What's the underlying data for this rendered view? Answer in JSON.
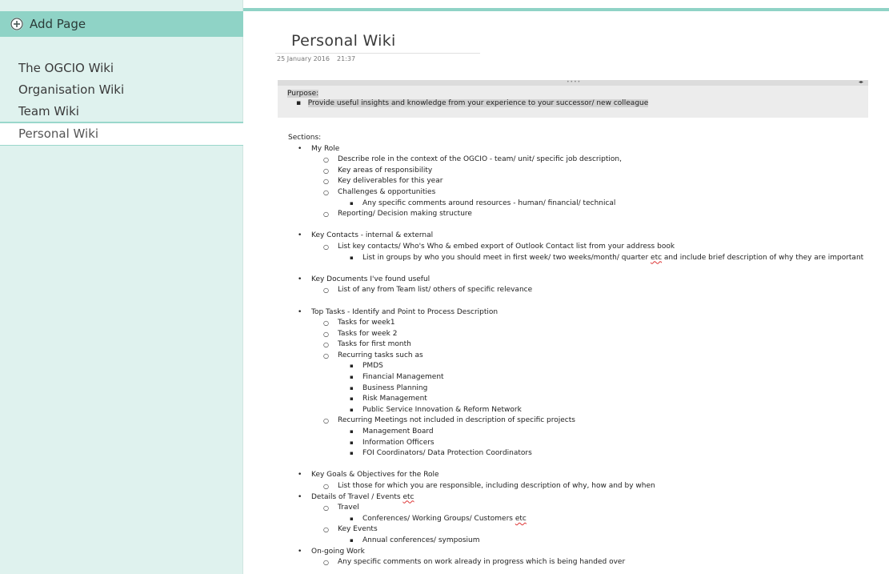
{
  "sidebar": {
    "add_page_label": "Add Page",
    "pages": [
      "The OGCIO Wiki",
      "Organisation Wiki",
      "Team Wiki",
      "Personal Wiki"
    ],
    "selected_index": 3
  },
  "page": {
    "title": "Personal Wiki",
    "date": "25 January 2016",
    "time": "21:37"
  },
  "purpose": {
    "label": "Purpose:",
    "item": "Provide useful insights and knowledge from your experience to your successor/ new colleague"
  },
  "sections_label": "Sections:",
  "outline": [
    {
      "level": 1,
      "text": "My Role"
    },
    {
      "level": 2,
      "text": "Describe role in the context of the OGCIO - team/ unit/ specific job description,"
    },
    {
      "level": 2,
      "text": "Key areas of responsibility"
    },
    {
      "level": 2,
      "text": "Key deliverables for this year"
    },
    {
      "level": 2,
      "text": "Challenges & opportunities"
    },
    {
      "level": 3,
      "text": "Any specific comments around resources - human/ financial/ technical"
    },
    {
      "level": 2,
      "text": "Reporting/ Decision making structure"
    },
    {
      "level": 0,
      "text": ""
    },
    {
      "level": 1,
      "text": "Key Contacts - internal & external"
    },
    {
      "level": 2,
      "text": "List key contacts/ Who's Who  & embed export of Outlook Contact list from your address book"
    },
    {
      "level": 3,
      "text": "List in groups by who you should meet in first week/ two weeks/month/ quarter etc and include brief description of why they are important",
      "wrap": true
    },
    {
      "level": 0,
      "text": ""
    },
    {
      "level": 1,
      "text": "Key Documents I've found useful"
    },
    {
      "level": 2,
      "text": "List of any from Team list/ others of specific relevance"
    },
    {
      "level": 0,
      "text": ""
    },
    {
      "level": 1,
      "text": "Top Tasks - Identify and Point to Process Description"
    },
    {
      "level": 2,
      "text": "Tasks for week1"
    },
    {
      "level": 2,
      "text": "Tasks for week 2"
    },
    {
      "level": 2,
      "text": "Tasks for first month"
    },
    {
      "level": 2,
      "text": "Recurring tasks such as"
    },
    {
      "level": 3,
      "text": "PMDS"
    },
    {
      "level": 3,
      "text": "Financial Management"
    },
    {
      "level": 3,
      "text": "Business Planning"
    },
    {
      "level": 3,
      "text": "Risk Management"
    },
    {
      "level": 3,
      "text": "Public Service Innovation & Reform Network"
    },
    {
      "level": 2,
      "text": "Recurring Meetings not included in description of specific projects"
    },
    {
      "level": 3,
      "text": "Management Board"
    },
    {
      "level": 3,
      "text": "Information Officers"
    },
    {
      "level": 3,
      "text": "FOI Coordinators/ Data Protection Coordinators"
    },
    {
      "level": 0,
      "text": ""
    },
    {
      "level": 1,
      "text": "Key Goals & Objectives for the Role"
    },
    {
      "level": 2,
      "text": "List those for which you are responsible, including description of why, how and by when"
    },
    {
      "level": 1,
      "text": "Details of Travel / Events etc"
    },
    {
      "level": 2,
      "text": "Travel"
    },
    {
      "level": 3,
      "text": "Conferences/ Working Groups/ Customers etc"
    },
    {
      "level": 2,
      "text": "Key Events"
    },
    {
      "level": 3,
      "text": "Annual conferences/ symposium"
    },
    {
      "level": 1,
      "text": "On-going Work"
    },
    {
      "level": 2,
      "text": "Any specific comments on work already in progress which is being handed over"
    }
  ],
  "colors": {
    "accent": "#8fd3c6",
    "sidebar_bg": "#dff2ee",
    "highlight": "#d2d2d2"
  }
}
